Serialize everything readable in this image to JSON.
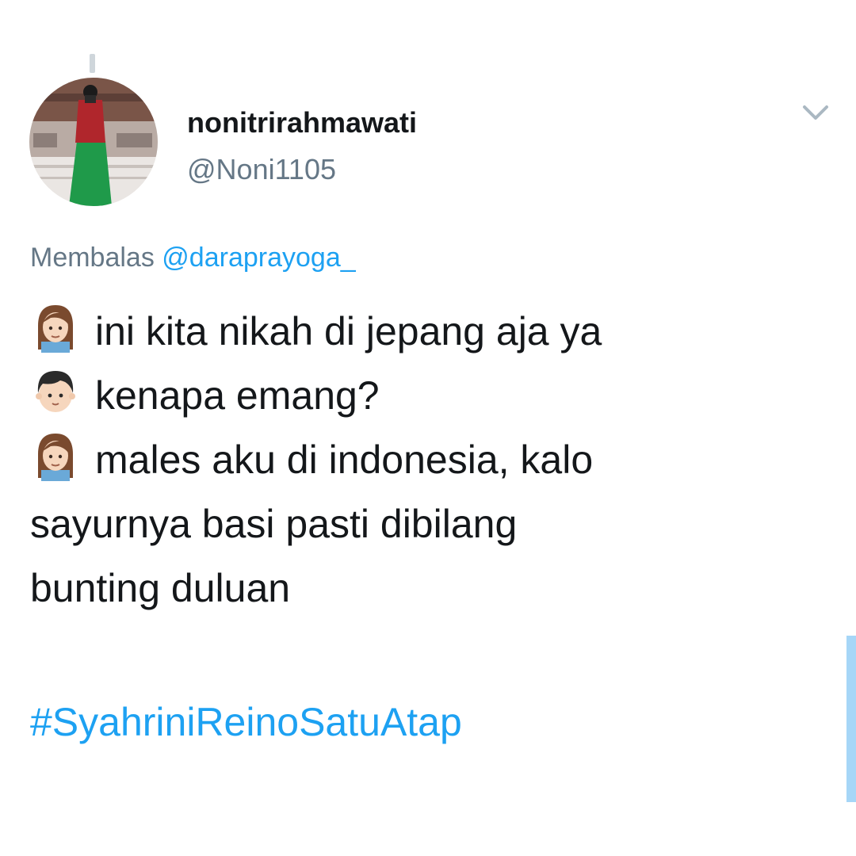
{
  "author": {
    "display_name": "nonitrirahmawati",
    "handle": "@Noni1105"
  },
  "reply": {
    "prefix": "Membalas",
    "mention": "@daraprayoga_"
  },
  "tweet": {
    "lines": [
      {
        "emoji": "woman-face-emoji",
        "text": "ini kita nikah di jepang aja ya"
      },
      {
        "emoji": "boy-face-emoji",
        "text": "kenapa emang?"
      },
      {
        "emoji": "woman-face-emoji",
        "text": "males aku di indonesia, kalo"
      },
      {
        "emoji": "",
        "text": "sayurnya basi pasti dibilang"
      },
      {
        "emoji": "",
        "text": "bunting duluan"
      }
    ],
    "hashtag": "#SyahriniReinoSatuAtap"
  },
  "icons": {
    "menu": "chevron-down-icon"
  },
  "colors": {
    "link": "#1da1f2",
    "secondary_text": "#657786",
    "primary_text": "#14171a",
    "scrollbar": "#a6d6f7"
  }
}
